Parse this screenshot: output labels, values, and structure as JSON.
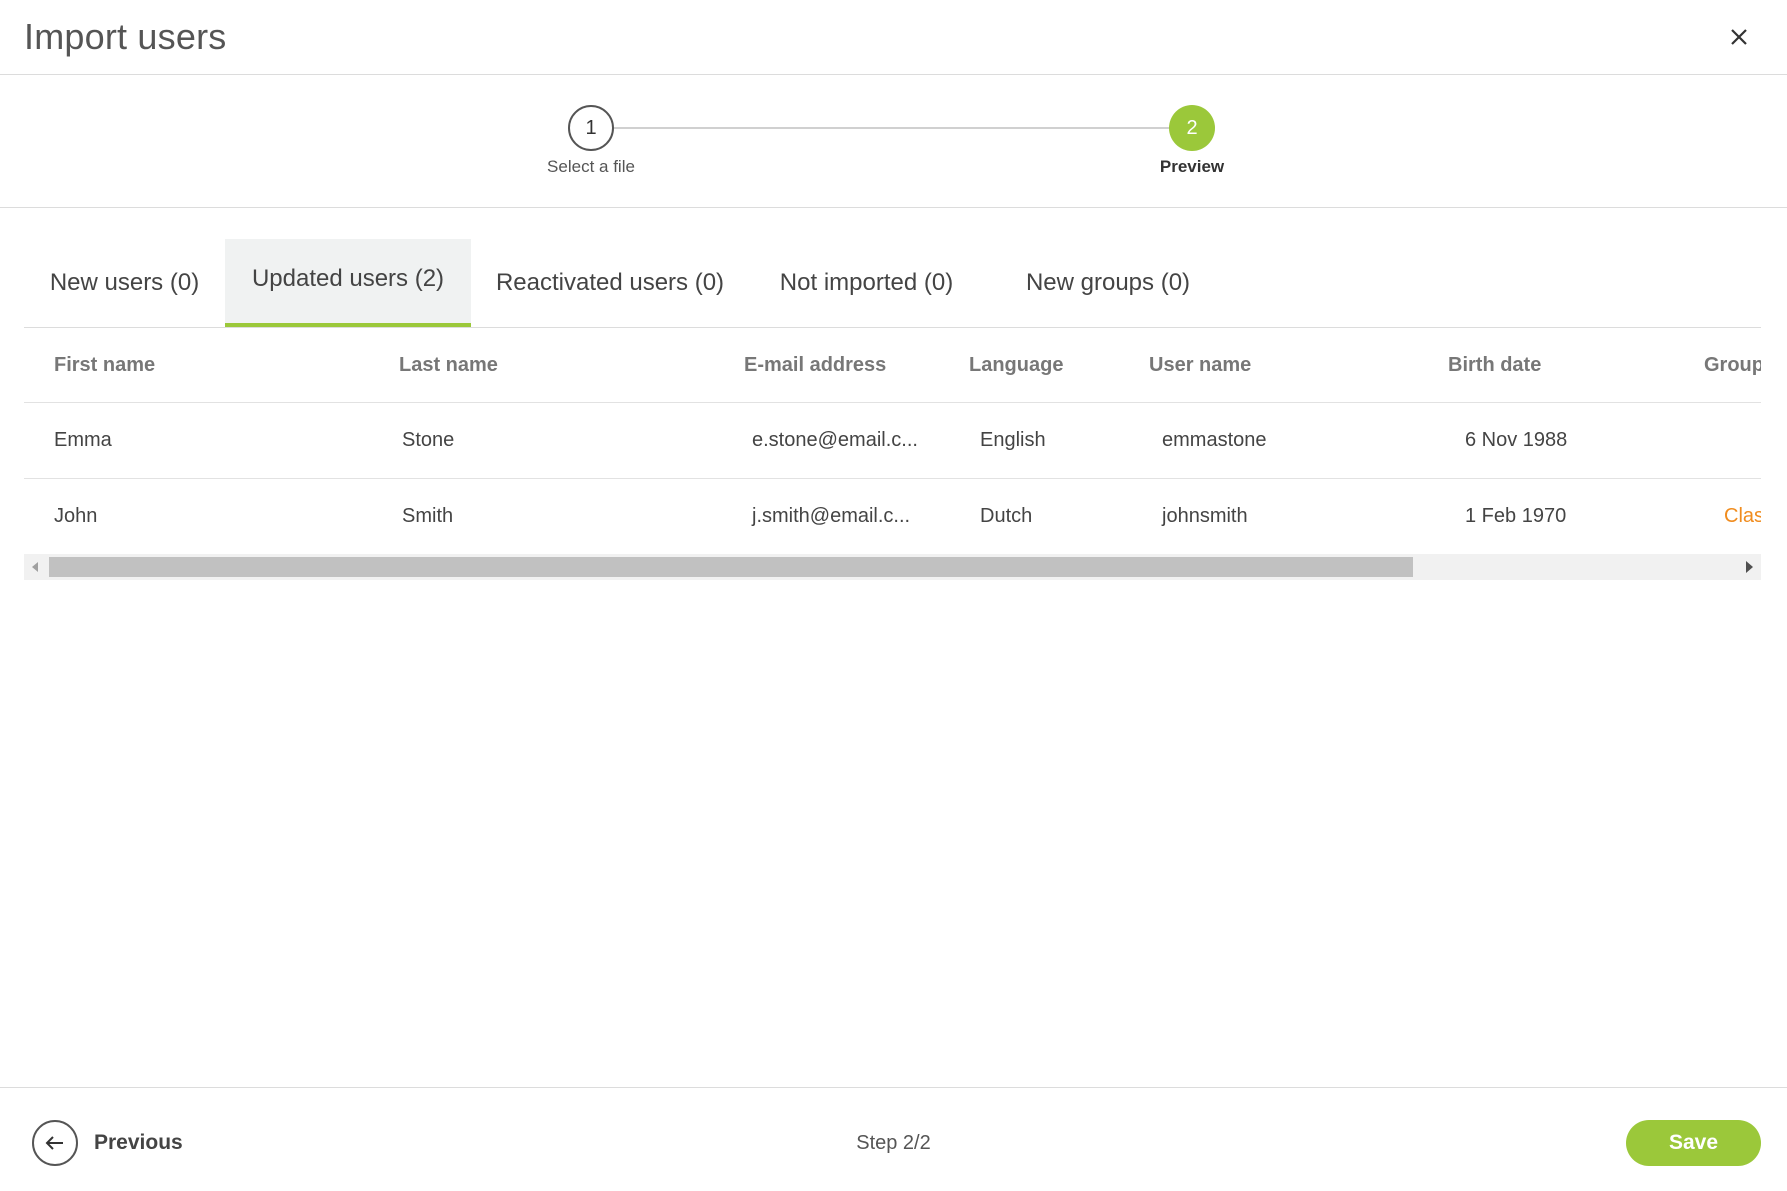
{
  "dialog": {
    "title": "Import users",
    "close_icon": "close-icon"
  },
  "stepper": {
    "steps": [
      {
        "number": "1",
        "label": "Select a file",
        "state": "completed"
      },
      {
        "number": "2",
        "label": "Preview",
        "state": "active"
      }
    ],
    "active_color": "#9bc83a"
  },
  "tabs": [
    {
      "label": "New users (0)",
      "active": false
    },
    {
      "label": "Updated users (2)",
      "active": true
    },
    {
      "label": "Reactivated users (0)",
      "active": false
    },
    {
      "label": "Not imported (0)",
      "active": false
    },
    {
      "label": "New groups (0)",
      "active": false
    }
  ],
  "table": {
    "columns": [
      "First name",
      "Last name",
      "E-mail address",
      "Language",
      "User name",
      "Birth date",
      "Group"
    ],
    "rows": [
      [
        "Emma",
        "Stone",
        "e.stone@email.c...",
        "English",
        "emmastone",
        "6 Nov 1988",
        ""
      ],
      [
        "John",
        "Smith",
        "j.smith@email.c...",
        "Dutch",
        "johnsmith",
        "1 Feb 1970",
        "Clas"
      ]
    ],
    "group_link_color": "#f08c1e"
  },
  "footer": {
    "previous_label": "Previous",
    "previous_icon": "arrow-left-icon",
    "step_counter": "Step 2/2",
    "save_label": "Save"
  }
}
